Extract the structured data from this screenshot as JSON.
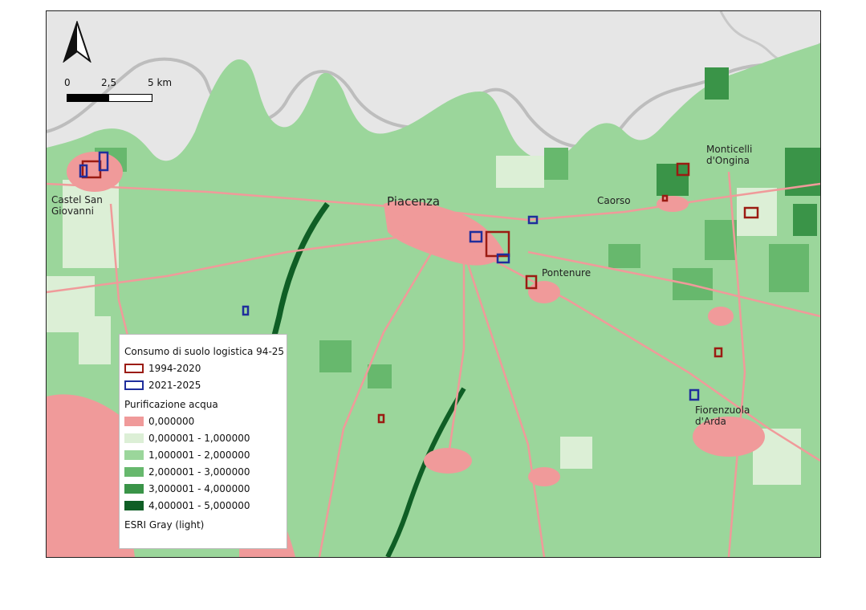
{
  "places": {
    "castel": "Castel San\nGiovanni",
    "piacenza": "Piacenza",
    "caorso": "Caorso",
    "monticelli": "Monticelli\nd'Ongina",
    "pontenure": "Pontenure",
    "fiorenzuola": "Fiorenzuola\nd'Arda"
  },
  "scale": {
    "labels": [
      "0",
      "2,5",
      "5 km"
    ]
  },
  "legend": {
    "title_consumo": "Consumo di suolo logistica 94-25",
    "consumo_items": [
      {
        "label": "1994-2020",
        "color": "#9b1b12"
      },
      {
        "label": "2021-2025",
        "color": "#1f2e9c"
      }
    ],
    "title_purificazione": "Purificazione acqua",
    "purificazione_items": [
      {
        "label": "0,000000",
        "color": "#f09a9a"
      },
      {
        "label": "0,000001 - 1,000000",
        "color": "#dcefd6"
      },
      {
        "label": "1,000001 - 2,000000",
        "color": "#9bd69b"
      },
      {
        "label": "2,000001 - 3,000000",
        "color": "#67b86d"
      },
      {
        "label": "3,000001 - 4,000000",
        "color": "#3a9448"
      },
      {
        "label": "4,000001 - 5,000000",
        "color": "#0f5e25"
      }
    ],
    "basemap": "ESRI Gray (light)"
  },
  "colors": {
    "background_gray": "#e6e6e6",
    "river_line": "#bdbdbd",
    "urban_pink": "#f09a9a"
  },
  "icons": {
    "north": "north-arrow-icon"
  }
}
